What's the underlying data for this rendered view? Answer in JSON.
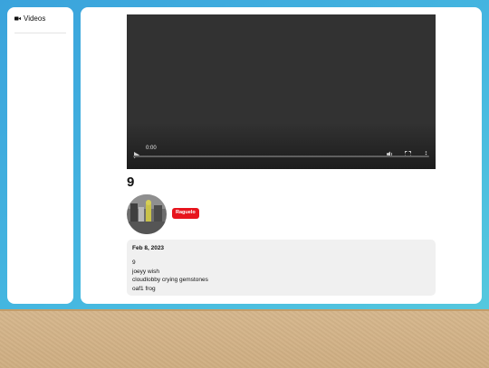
{
  "sidebar": {
    "videos_icon": "video-camera-icon",
    "videos_label": "Videos"
  },
  "player": {
    "time": "0:00"
  },
  "video": {
    "title": "9",
    "channel_badge": "Raguelo",
    "date": "Feb 8, 2023",
    "description_lines": [
      "9",
      "joeyy wish",
      "cloudlobby crying gemstones",
      "oaf1 frog"
    ]
  },
  "colors": {
    "background_sky": "#3aa3dc",
    "badge": "#e7141d",
    "video_bg": "#323232"
  }
}
